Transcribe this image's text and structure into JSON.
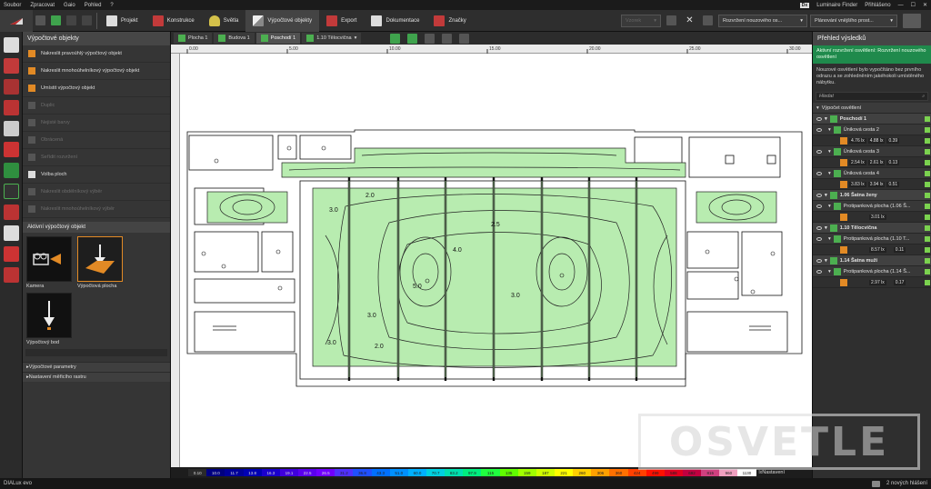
{
  "menu": [
    "Soubor",
    "Zpracovat",
    "Gaio",
    "Pohled",
    "?"
  ],
  "menu_right": {
    "dx": "Dx",
    "finder": "Luminaire Finder",
    "login": "Přihlášeno"
  },
  "toolbar": {
    "project": "Projekt",
    "construction": "Konstrukce",
    "lights": "Světla",
    "calc_objects": "Výpočtové objekty",
    "export": "Export",
    "documentation": "Dokumentace",
    "marks": "Značky",
    "field_label": "Vzorek",
    "dropdown1": "Rozvržení nouzového os...",
    "dropdown2": "Plánování vnějšího prost..."
  },
  "left_panel": {
    "title": "Výpočtové objekty",
    "items": [
      {
        "label": "Nakreslit pravoúhlý výpočtový objekt",
        "dim": false
      },
      {
        "label": "Nakreslit mnohoúhelníkový výpočtový objekt",
        "dim": false
      },
      {
        "label": "Umístit výpočtový objekt",
        "dim": false
      },
      {
        "label": "Duplic",
        "dim": true
      },
      {
        "label": "Nejisté barvy",
        "dim": true
      },
      {
        "label": "Obrácená",
        "dim": true
      },
      {
        "label": "Seřídit rozvržení",
        "dim": true
      },
      {
        "label": "Volba ploch",
        "dim": false
      },
      {
        "label": "Nakreslit obdélníkový výběr",
        "dim": true
      },
      {
        "label": "Nakreslit mnohoúhelníkový výběr",
        "dim": true
      }
    ],
    "active_title": "Aktivní výpočtový objekt",
    "tiles": [
      {
        "label": "Kamera"
      },
      {
        "label": "Výpočtová plocha"
      },
      {
        "label": "Výpočtový bod"
      }
    ],
    "sections": [
      "Výpočtové parametry",
      "Nastavení měřicího rastru"
    ]
  },
  "doc_tabs": [
    "Plocha 1",
    "Budova 1",
    "Poschodí 1",
    "1.10 Tělocvična"
  ],
  "ruler_ticks": [
    "0.00",
    "5.00",
    "10.00",
    "15.00",
    "20.00",
    "25.00",
    "30.00"
  ],
  "legend": {
    "values": [
      "0.10",
      "10.0",
      "11.7",
      "13.8",
      "16.3",
      "19.1",
      "22.5",
      "26.5",
      "31.2",
      "36.8",
      "43.3",
      "51.0",
      "60.0",
      "70.7",
      "83.2",
      "97.9",
      "115",
      "135",
      "159",
      "187",
      "221",
      "260",
      "306",
      "360",
      "424",
      "499",
      "588",
      "692",
      "815",
      "960",
      "1130"
    ],
    "colors": [
      "#2a2a2a",
      "#000080",
      "#000099",
      "#0000b3",
      "#1a00cc",
      "#4000dd",
      "#5a00ee",
      "#7000ff",
      "#5030ff",
      "#2050ff",
      "#0070ff",
      "#0090ff",
      "#00b0ff",
      "#00d0e0",
      "#00e0b0",
      "#00ee80",
      "#20ff40",
      "#60ff00",
      "#a0ff00",
      "#d0ff00",
      "#ffff00",
      "#ffd000",
      "#ffa000",
      "#ff7000",
      "#ff4000",
      "#ff1000",
      "#e00020",
      "#c00040",
      "#d04080",
      "#f0a0c0",
      "#ffffff"
    ],
    "unit": "lx",
    "setting": "Nastavení"
  },
  "right_panel": {
    "title": "Přehled výsledků",
    "green_msg": "Aktivní rozvržení osvětlení: Rozvržení nouzového osvětlení",
    "msg": "Nouzové osvětlení bylo vypočítáno bez prvního odrazu a se zohledněním jakéhokoli umístěného nábytku.",
    "search_placeholder": "Hledat",
    "tree_root": "Výpočet osvětlení",
    "floor": "Poschodí 1",
    "routes": [
      {
        "name": "Úniková cesta 2",
        "v1": "4.76 lx",
        "v2": "4.88 lx",
        "v3": "0.39"
      },
      {
        "name": "Úniková cesta 3",
        "v1": "2.54 lx",
        "v2": "2.61 lx",
        "v3": "0.13"
      },
      {
        "name": "Úniková cesta 4",
        "v1": "3.83 lx",
        "v2": "3.94 lx",
        "v3": "0.51"
      }
    ],
    "rooms": [
      {
        "room": "1.06 Šatna ženy",
        "surface": "Protipanková plocha (1.06 Š...",
        "v1": "3.01 lx",
        "v3": ""
      },
      {
        "room": "1.10 Tělocvična",
        "surface": "Protipanková plocha (1.10 T...",
        "v1": "8.57 lx",
        "v3": "0.11"
      },
      {
        "room": "1.14 Šatna muži",
        "surface": "Protipanková plocha (1.14 Š...",
        "v1": "2.97 lx",
        "v3": "0.17"
      }
    ]
  },
  "status": {
    "app": "DIALux evo",
    "messages": "2 nových hlášení"
  },
  "contour_labels": [
    "2.0",
    "2.5",
    "3.0",
    "4.0",
    "5.0"
  ],
  "watermark": "OSVETLE"
}
